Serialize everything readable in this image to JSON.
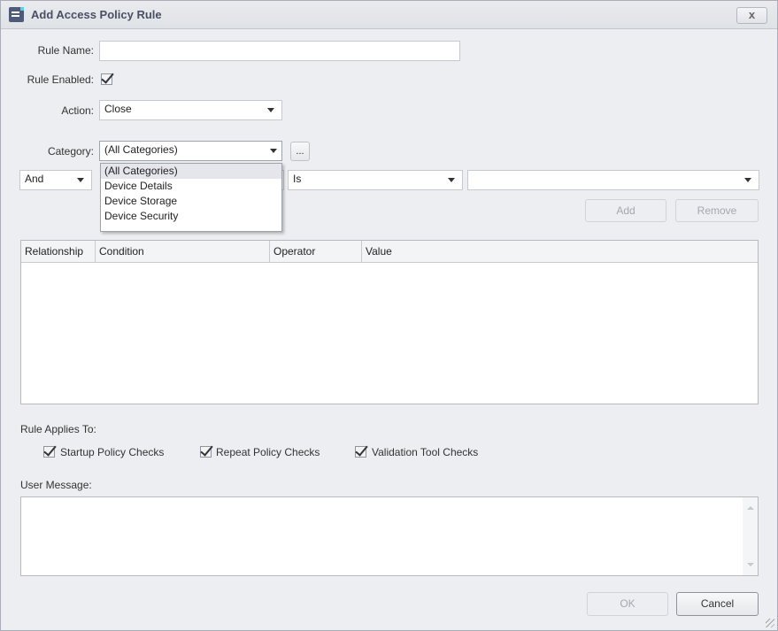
{
  "window": {
    "title": "Add Access Policy Rule",
    "icon": "document-icon",
    "close_label": "x"
  },
  "form": {
    "rule_name_label": "Rule Name:",
    "rule_name_value": "",
    "rule_enabled_label": "Rule Enabled:",
    "rule_enabled_checked": true,
    "action_label": "Action:",
    "action_value": "Close",
    "category_label": "Category:",
    "category_value": "(All Categories)",
    "category_browse_label": "...",
    "category_options": [
      "(All Categories)",
      "Device Details",
      "Device Storage",
      "Device Security"
    ],
    "category_selected_option": "(All Categories)"
  },
  "condition_builder": {
    "relationship_value": "And",
    "operator_value": "Is",
    "value_value": "",
    "add_label": "Add",
    "remove_label": "Remove"
  },
  "conditions_grid": {
    "columns": [
      "Relationship",
      "Condition",
      "Operator",
      "Value"
    ],
    "rows": []
  },
  "applies_to": {
    "label": "Rule Applies To:",
    "options": [
      {
        "label": "Startup Policy Checks",
        "checked": true
      },
      {
        "label": "Repeat Policy Checks",
        "checked": true
      },
      {
        "label": "Validation Tool Checks",
        "checked": true
      }
    ]
  },
  "user_message": {
    "label": "User Message:",
    "value": ""
  },
  "footer": {
    "ok_label": "OK",
    "cancel_label": "Cancel"
  }
}
